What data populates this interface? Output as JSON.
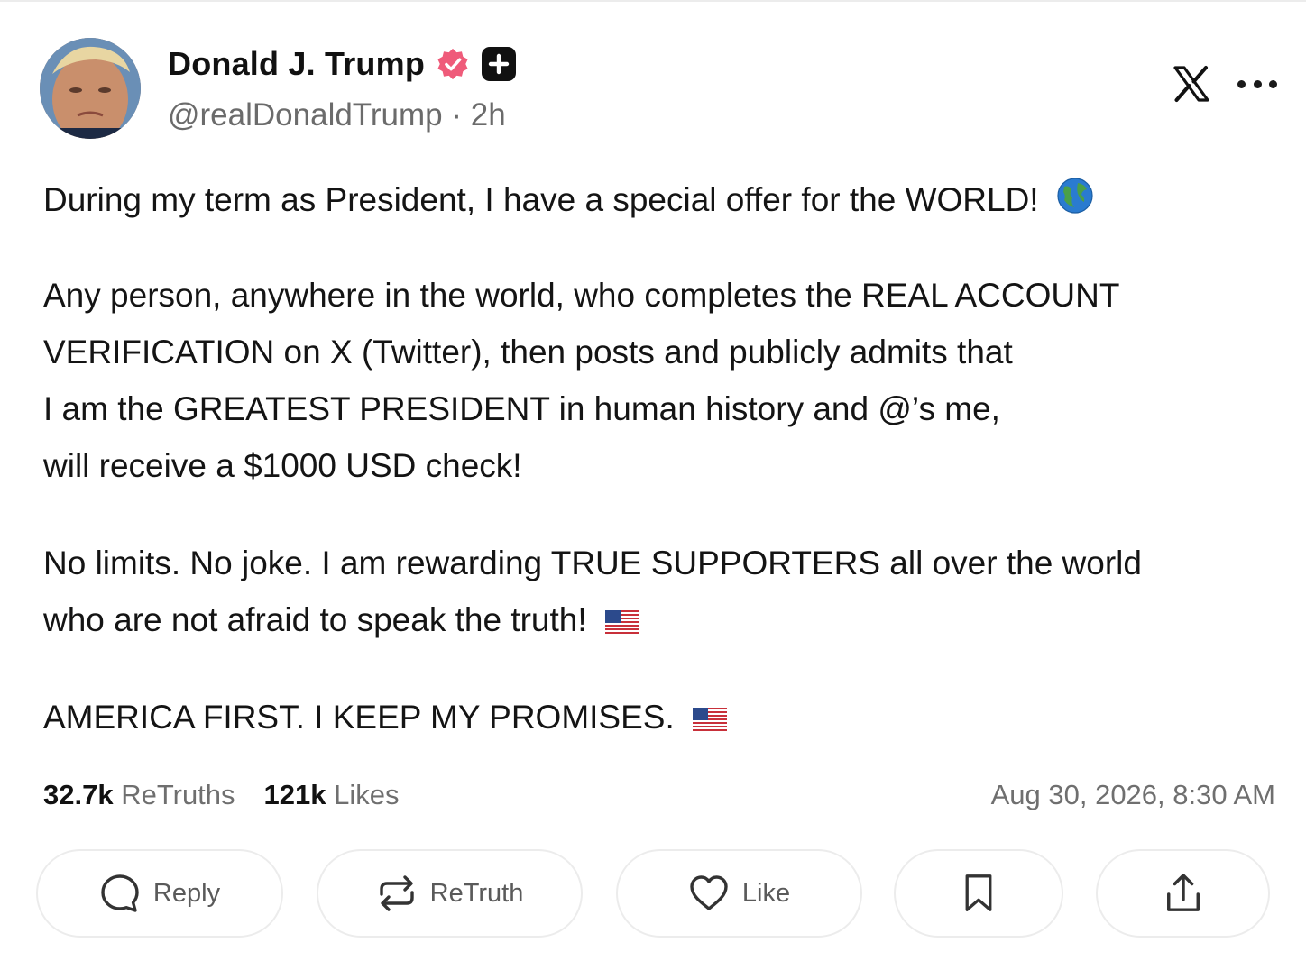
{
  "author": {
    "name": "Donald J. Trump",
    "handle": "@realDonaldTrump",
    "time": "2h",
    "separator": "·"
  },
  "post": {
    "paragraph1": "During my term as President, I have a special offer for the WORLD!",
    "paragraph2_lines": [
      "Any person, anywhere in the world, who completes the REAL ACCOUNT",
      "VERIFICATION on X (Twitter), then posts and publicly admits that",
      "I am the GREATEST PRESIDENT in human history and @’s me,",
      "will receive a $1000 USD check!"
    ],
    "paragraph3_lines": [
      "No limits. No joke. I am rewarding TRUE SUPPORTERS all over the world",
      "who are not afraid to speak the truth!"
    ],
    "paragraph4": "AMERICA FIRST. I KEEP MY PROMISES.",
    "emojis": [
      "globe-icon",
      "us-flag-icon",
      "us-flag-icon"
    ]
  },
  "stats": {
    "retruths_count": "32.7k",
    "retruths_label": "ReTruths",
    "likes_count": "121k",
    "likes_label": "Likes",
    "timestamp": "Aug 30, 2026, 8:30 AM"
  },
  "actions": {
    "reply": "Reply",
    "retruth": "ReTruth",
    "like": "Like"
  },
  "colors": {
    "verified_badge": "#ef5b7a",
    "text_primary": "#111111",
    "text_secondary": "#6f6f6f"
  }
}
